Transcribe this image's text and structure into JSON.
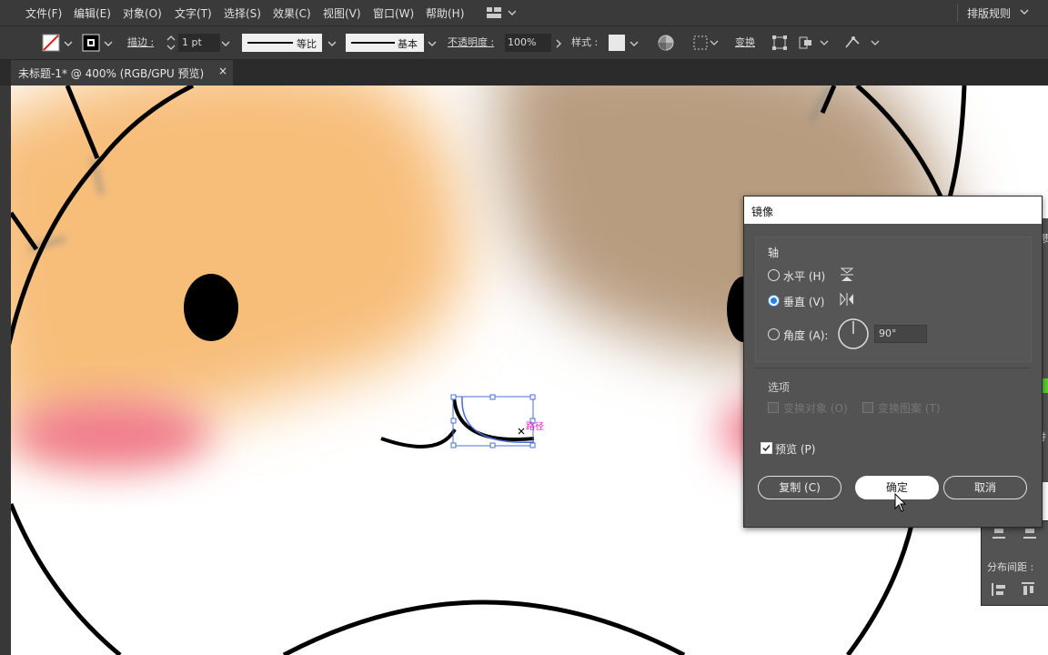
{
  "menu": [
    "文件(F)",
    "编辑(E)",
    "对象(O)",
    "文字(T)",
    "选择(S)",
    "效果(C)",
    "视图(V)",
    "窗口(W)",
    "帮助(H)"
  ],
  "workspace": "排版规则",
  "toolbar": {
    "stroke_label": "描边 :",
    "stroke_value": "1 pt",
    "profile1": "等比",
    "profile2": "基本",
    "opacity_label": "不透明度 :",
    "opacity_value": "100%",
    "style_label": "样式 :",
    "transform_label": "变换"
  },
  "tab": {
    "title": "未标题-1* @ 400% (RGB/GPU 预览)",
    "close": "×"
  },
  "canvas": {
    "anchor_label": "路径"
  },
  "dialog": {
    "title": "镜像",
    "axis_section": "轴",
    "horizontal": "水平 (H)",
    "vertical": "垂直 (V)",
    "angle": "角度 (A):",
    "angle_value": "90°",
    "options_section": "选项",
    "transform_objects": "变换对象 (O)",
    "transform_patterns": "变换图案 (T)",
    "preview": "预览 (P)",
    "copy_button": "复制 (C)",
    "ok_button": "确定",
    "cancel_button": "取消",
    "selected_axis": "vertical"
  },
  "right_panel": {
    "distribute_label": "分布间距 :",
    "partial_1": "质",
    "partial_2": "扌"
  },
  "colors": {
    "accent": "#2f7fe0",
    "selection": "#4a6cd4",
    "path_label": "#e020c0"
  }
}
